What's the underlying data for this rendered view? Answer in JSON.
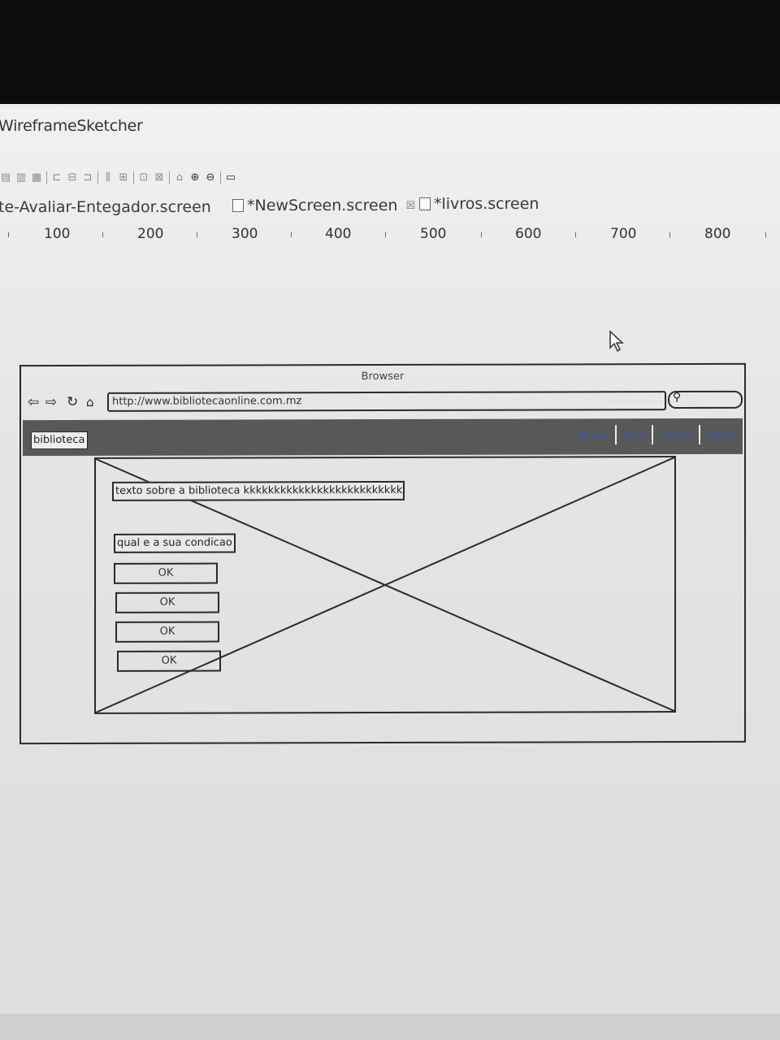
{
  "app": {
    "title": "WireframeSketcher"
  },
  "toolbar": {
    "icons": [
      "save-icon",
      "save-all-icon",
      "print-icon",
      "align-left-icon",
      "align-center-icon",
      "align-right-icon",
      "distribute-icon",
      "group-icon",
      "ungroup-icon",
      "lock-icon",
      "zoom-in-icon",
      "zoom-out-icon",
      "preview-icon"
    ]
  },
  "tabs": [
    {
      "label": "te-Avaliar-Entegador.screen"
    },
    {
      "label": "*NewScreen.screen",
      "close": "☒"
    },
    {
      "label": "*livros.screen"
    }
  ],
  "ruler": {
    "marks": [
      "100",
      "200",
      "300",
      "400",
      "500",
      "600",
      "700",
      "800"
    ]
  },
  "wireframe": {
    "browser_title": "Browser",
    "url": "http://www.bibliotecaonline.com.mz",
    "nav": {
      "brand": "biblioteca",
      "links": [
        "Home",
        "Blog",
        "Forum",
        "About"
      ]
    },
    "content": {
      "text_label": "texto sobre a biblioteca kkkkkkkkkkkkkkkkkkkkkkkkkkkkkk",
      "question_label": "qual e a sua condicao",
      "buttons": [
        "OK",
        "OK",
        "OK",
        "OK"
      ]
    }
  }
}
